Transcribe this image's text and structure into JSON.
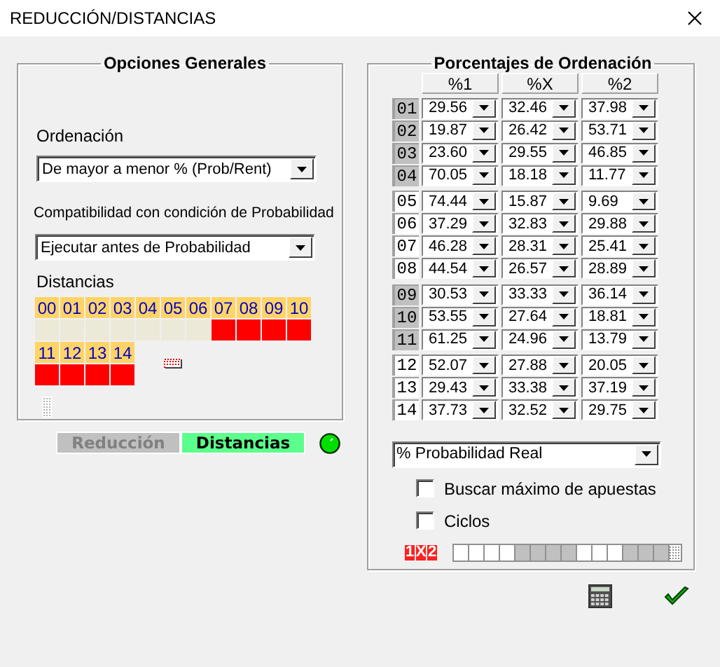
{
  "window": {
    "title": "REDUCCIÓN/DISTANCIAS"
  },
  "general_options": {
    "title": "Opciones Generales",
    "ordering_label": "Ordenación",
    "ordering_value": "De mayor a menor % (Prob/Rent)",
    "compat_label": "Compatibilidad con condición de Probabilidad",
    "compat_value": "Ejecutar antes de Probabilidad",
    "distances_label": "Distancias",
    "distances": [
      {
        "label": "00",
        "marked": false
      },
      {
        "label": "01",
        "marked": false
      },
      {
        "label": "02",
        "marked": false
      },
      {
        "label": "03",
        "marked": false
      },
      {
        "label": "04",
        "marked": false
      },
      {
        "label": "05",
        "marked": false
      },
      {
        "label": "06",
        "marked": false
      },
      {
        "label": "07",
        "marked": true
      },
      {
        "label": "08",
        "marked": true
      },
      {
        "label": "09",
        "marked": true
      },
      {
        "label": "10",
        "marked": true
      },
      {
        "label": "11",
        "marked": true
      },
      {
        "label": "12",
        "marked": true
      },
      {
        "label": "13",
        "marked": true
      },
      {
        "label": "14",
        "marked": true
      }
    ]
  },
  "tabs": [
    {
      "label": "Reducción",
      "selected": false
    },
    {
      "label": "Distancias",
      "selected": true
    }
  ],
  "ordering_percentages": {
    "title": "Porcentajes de Ordenación",
    "columns": [
      "%1",
      "%X",
      "%2"
    ],
    "rows": [
      {
        "label": "01",
        "shaded": true,
        "values": [
          "29.56",
          "32.46",
          "37.98"
        ]
      },
      {
        "label": "02",
        "shaded": true,
        "values": [
          "19.87",
          "26.42",
          "53.71"
        ]
      },
      {
        "label": "03",
        "shaded": true,
        "values": [
          "23.60",
          "29.55",
          "46.85"
        ]
      },
      {
        "label": "04",
        "shaded": true,
        "values": [
          "70.05",
          "18.18",
          "11.77"
        ]
      },
      {
        "label": "05",
        "shaded": false,
        "values": [
          "74.44",
          "15.87",
          "9.69"
        ]
      },
      {
        "label": "06",
        "shaded": false,
        "values": [
          "37.29",
          "32.83",
          "29.88"
        ]
      },
      {
        "label": "07",
        "shaded": false,
        "values": [
          "46.28",
          "28.31",
          "25.41"
        ]
      },
      {
        "label": "08",
        "shaded": false,
        "values": [
          "44.54",
          "26.57",
          "28.89"
        ]
      },
      {
        "label": "09",
        "shaded": true,
        "values": [
          "30.53",
          "33.33",
          "36.14"
        ]
      },
      {
        "label": "10",
        "shaded": true,
        "values": [
          "53.55",
          "27.64",
          "18.81"
        ]
      },
      {
        "label": "11",
        "shaded": true,
        "values": [
          "61.25",
          "24.96",
          "13.79"
        ]
      },
      {
        "label": "12",
        "shaded": false,
        "values": [
          "52.07",
          "27.88",
          "20.05"
        ]
      },
      {
        "label": "13",
        "shaded": false,
        "values": [
          "29.43",
          "33.38",
          "37.19"
        ]
      },
      {
        "label": "14",
        "shaded": false,
        "values": [
          "37.73",
          "32.52",
          "29.75"
        ]
      }
    ],
    "sort_by": "% Probabilidad Real",
    "options": [
      {
        "label": "Buscar máximo de apuestas",
        "checked": false
      },
      {
        "label": "Ciclos",
        "checked": false
      }
    ],
    "logo": "1X2",
    "strip": [
      {
        "shaded": false
      },
      {
        "shaded": false
      },
      {
        "shaded": false
      },
      {
        "shaded": false
      },
      {
        "shaded": true
      },
      {
        "shaded": true
      },
      {
        "shaded": true
      },
      {
        "shaded": true
      },
      {
        "shaded": false
      },
      {
        "shaded": false
      },
      {
        "shaded": false
      },
      {
        "shaded": true
      },
      {
        "shaded": true
      },
      {
        "shaded": true
      }
    ]
  }
}
